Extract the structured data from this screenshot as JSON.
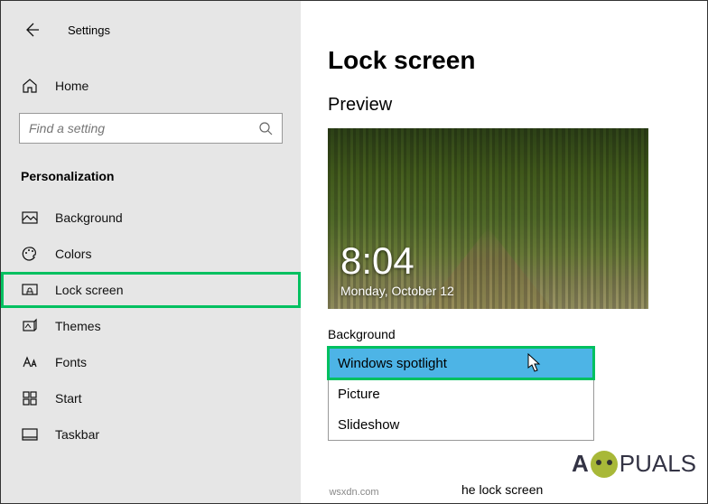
{
  "sidebar": {
    "title": "Settings",
    "home_label": "Home",
    "search_placeholder": "Find a setting",
    "section_header": "Personalization",
    "items": [
      {
        "label": "Background"
      },
      {
        "label": "Colors"
      },
      {
        "label": "Lock screen"
      },
      {
        "label": "Themes"
      },
      {
        "label": "Fonts"
      },
      {
        "label": "Start"
      },
      {
        "label": "Taskbar"
      }
    ]
  },
  "main": {
    "page_title": "Lock screen",
    "preview_label": "Preview",
    "preview_time": "8:04",
    "preview_date": "Monday, October 12",
    "background_label": "Background",
    "dropdown": {
      "selected": "Windows spotlight",
      "options": [
        "Picture",
        "Slideshow"
      ]
    },
    "extra_text": "he lock screen"
  },
  "watermark": "wsxdn.com",
  "logo_text_1": "A",
  "logo_text_2": "PUALS"
}
